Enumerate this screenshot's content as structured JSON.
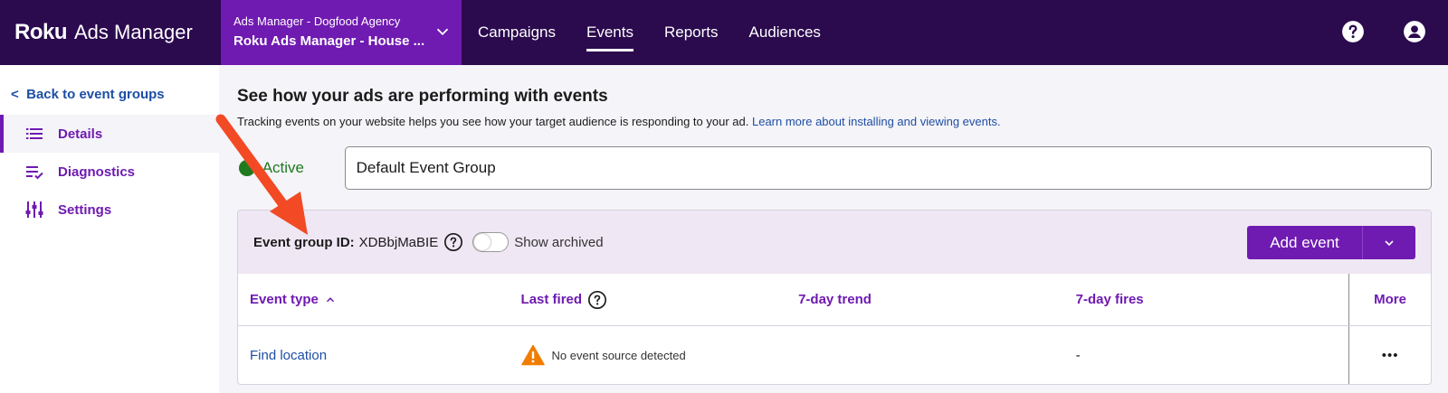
{
  "header": {
    "logo": "Roku",
    "product": "Ads Manager",
    "agency": "Ads Manager - Dogfood Agency",
    "account": "Roku Ads Manager - House ...",
    "nav": [
      {
        "label": "Campaigns"
      },
      {
        "label": "Events"
      },
      {
        "label": "Reports"
      },
      {
        "label": "Audiences"
      }
    ],
    "active_nav": "Events",
    "icons": [
      "help-icon",
      "account-icon"
    ]
  },
  "sidebar": {
    "back_label": "Back to event groups",
    "back_chevron": "<",
    "items": [
      {
        "label": "Details",
        "icon": "list-icon"
      },
      {
        "label": "Diagnostics",
        "icon": "checklist-icon"
      },
      {
        "label": "Settings",
        "icon": "sliders-icon"
      }
    ]
  },
  "main": {
    "headline": "See how your ads are performing with events",
    "subline": "Tracking events on your website helps you see how your target audience is responding to your ad.",
    "learn_more": "Learn more about installing and viewing events.",
    "status": "Active",
    "group_name": "Default Event Group",
    "card": {
      "gid_label": "Event group ID:",
      "gid_value": "XDBbjMaBIE",
      "show_archived_label": "Show archived",
      "show_archived": false,
      "add_event_label": "Add event",
      "columns": {
        "event_type": "Event type",
        "last_fired": "Last fired",
        "trend": "7-day trend",
        "fires": "7-day fires",
        "more": "More"
      },
      "rows": [
        {
          "event_type": "Find location",
          "last_fired": "No event source detected",
          "trend": "",
          "fires": "-",
          "more": "•••"
        }
      ]
    }
  },
  "colors": {
    "topbar": "#2b0a4e",
    "account_bg": "#6f1ab1",
    "accent": "#6f1ab1",
    "link": "#1d4ea6",
    "active_green": "#1f7a1f",
    "warning": "#f07d00",
    "annotation_arrow": "#f24a24"
  }
}
